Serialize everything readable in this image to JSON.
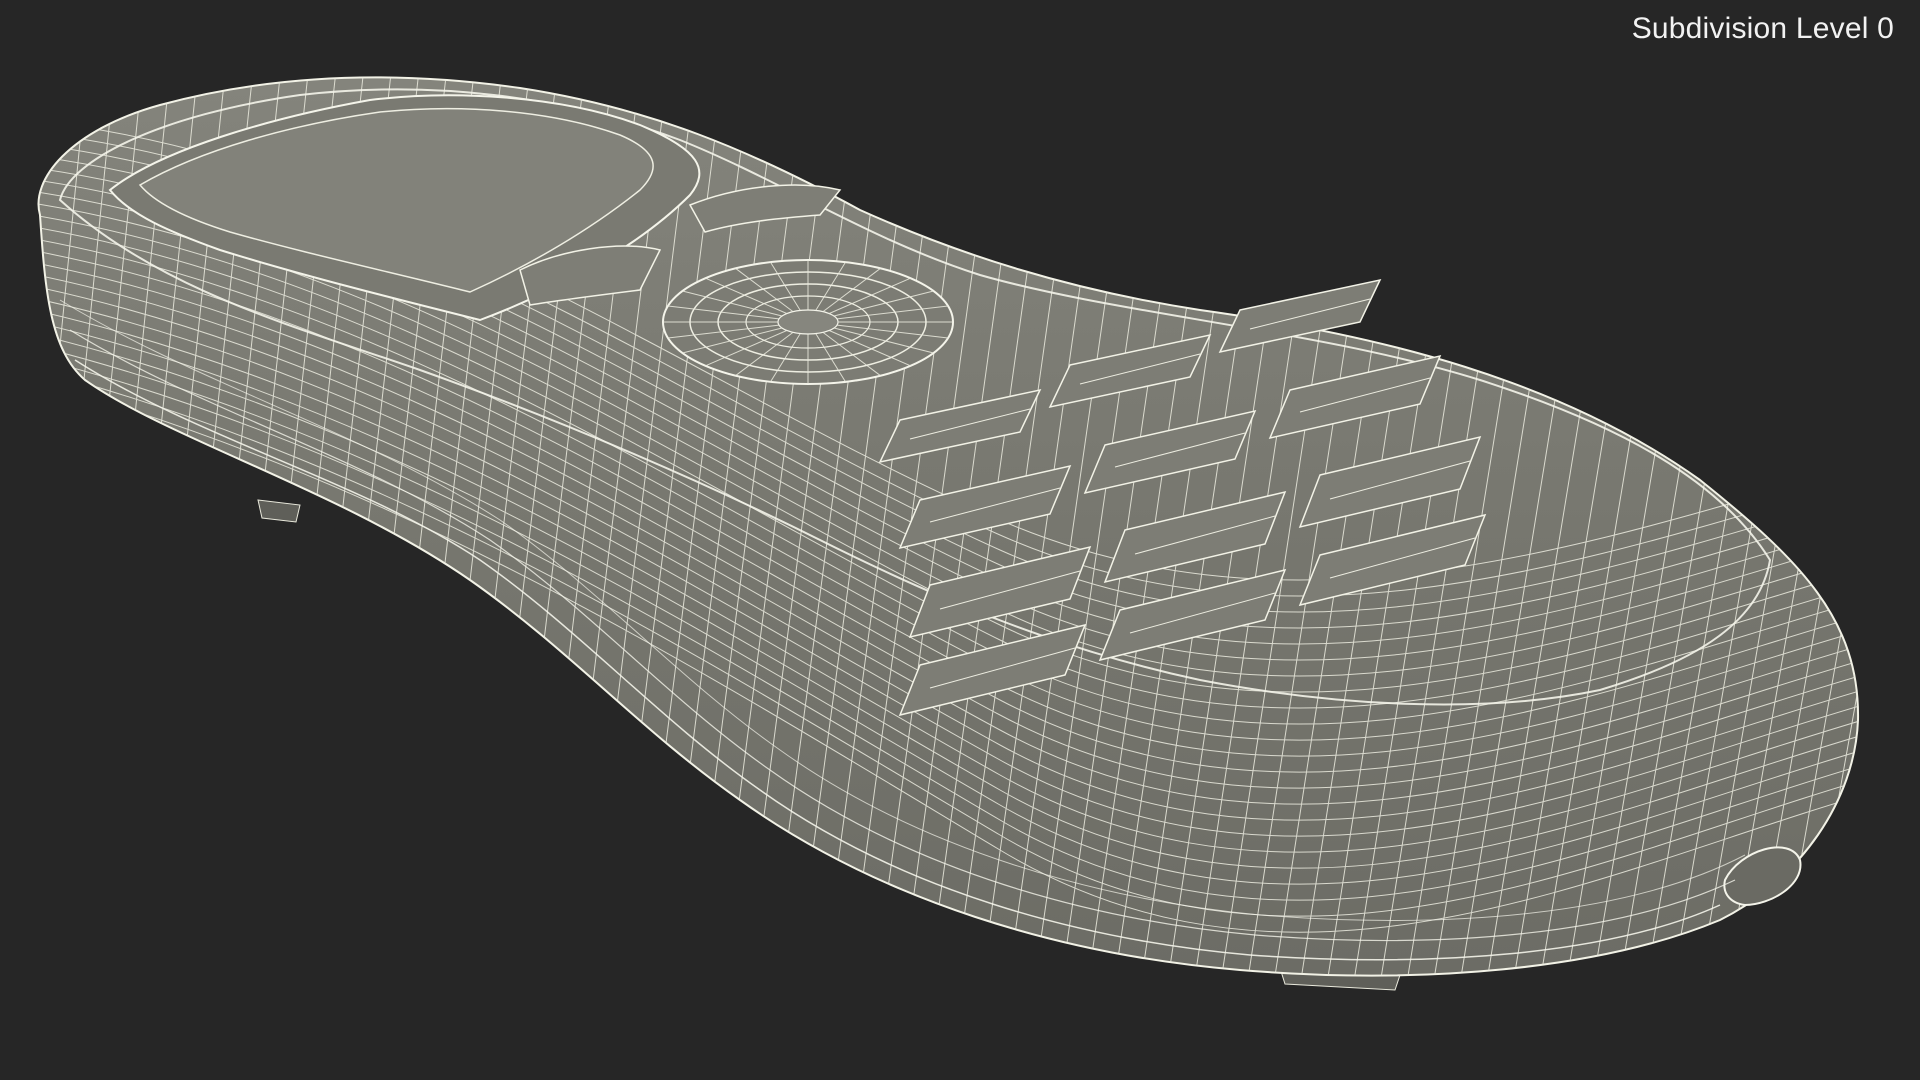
{
  "viewport": {
    "caption": "Subdivision Level 0",
    "background_color": "#262626",
    "mesh_fill_color": "#777770",
    "wire_color": "#efefe4"
  },
  "model": {
    "subject": "handheld-remote-wireframe",
    "icon": "wireframe-mesh-icon"
  }
}
